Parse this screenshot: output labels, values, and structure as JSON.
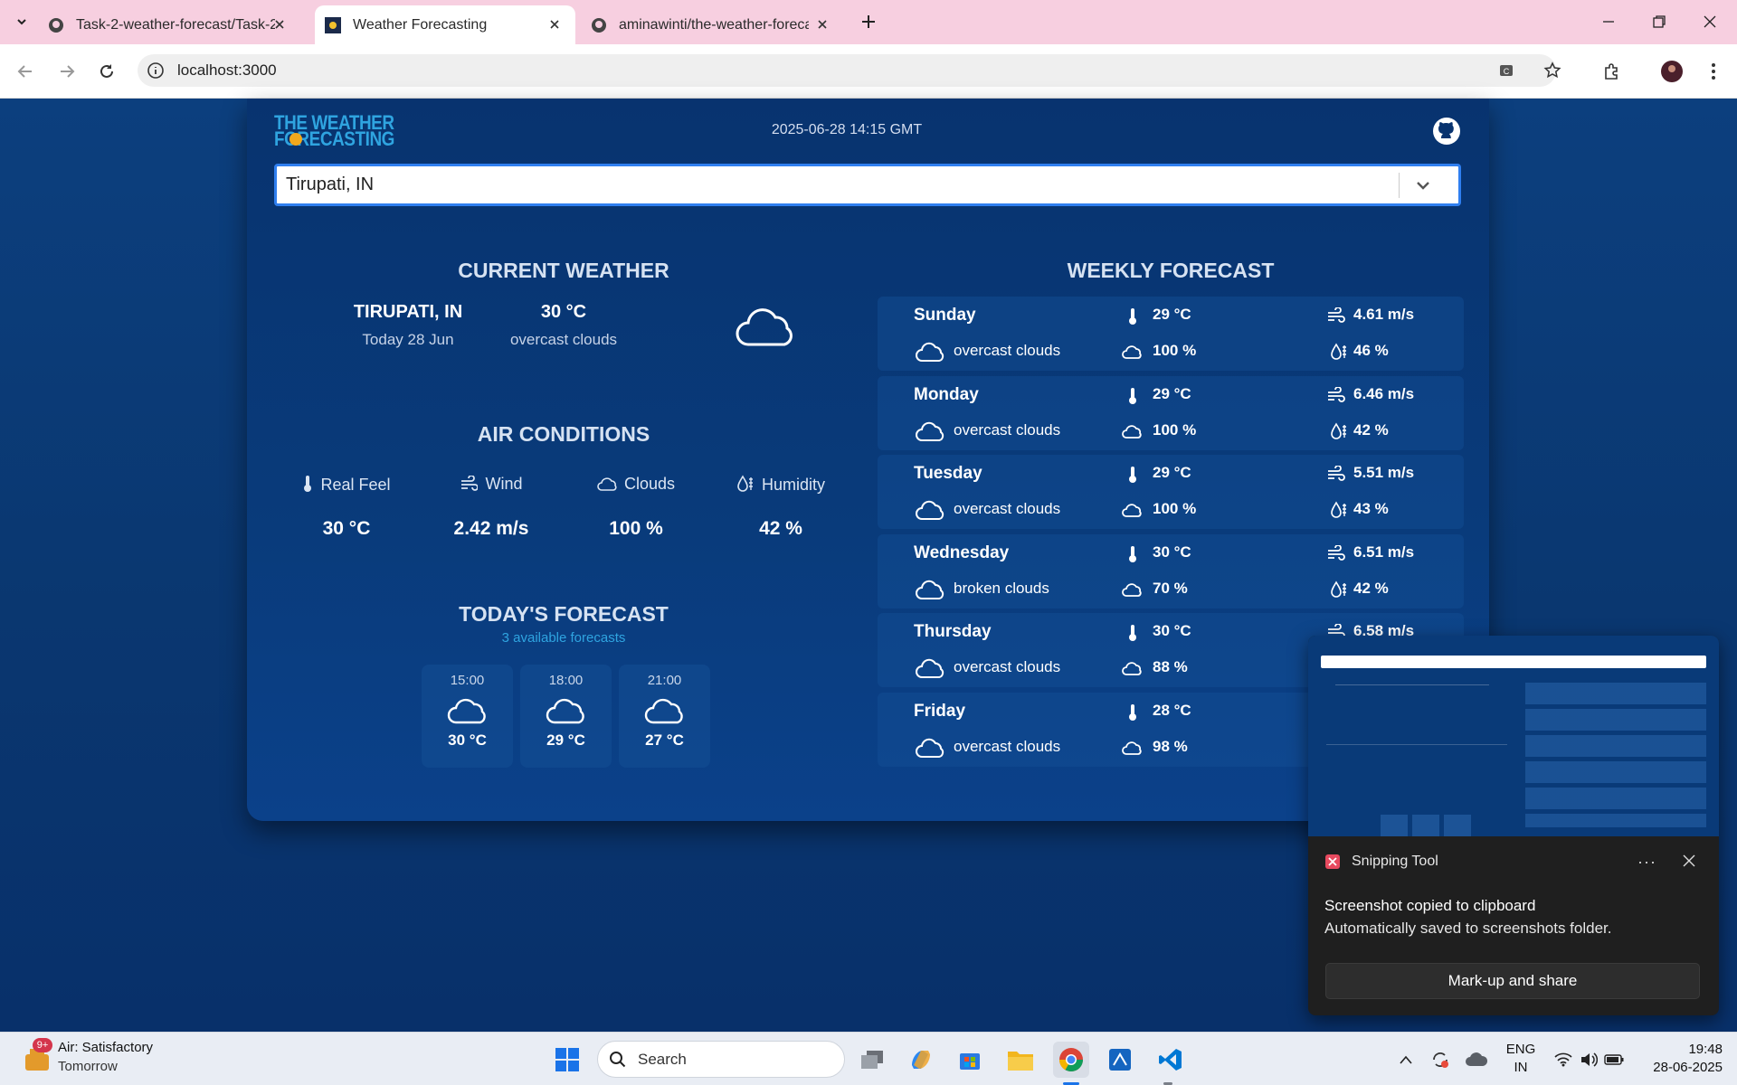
{
  "browser": {
    "tabs": [
      {
        "title": "Task-2-weather-forecast/Task-2",
        "active": false
      },
      {
        "title": "Weather Forecasting",
        "active": true
      },
      {
        "title": "aminawinti/the-weather-foreca",
        "active": false
      }
    ],
    "address": "localhost:3000"
  },
  "app": {
    "logo_line1": "THE WEATHER",
    "logo_line2": "FORECASTING",
    "datetime": "2025-06-28 14:15 GMT",
    "search_value": "Tirupati, IN"
  },
  "current": {
    "heading": "CURRENT WEATHER",
    "city": "TIRUPATI, IN",
    "date": "Today 28 Jun",
    "temp": "30 °C",
    "description": "overcast clouds"
  },
  "air": {
    "heading": "AIR CONDITIONS",
    "items": [
      {
        "label": "Real Feel",
        "value": "30 °C",
        "icon": "thermometer-icon"
      },
      {
        "label": "Wind",
        "value": "2.42 m/s",
        "icon": "wind-icon"
      },
      {
        "label": "Clouds",
        "value": "100 %",
        "icon": "cloud-icon"
      },
      {
        "label": "Humidity",
        "value": "42 %",
        "icon": "humidity-icon"
      }
    ]
  },
  "today": {
    "heading": "TODAY'S FORECAST",
    "subtitle": "3 available forecasts",
    "hours": [
      {
        "time": "15:00",
        "temp": "30 °C"
      },
      {
        "time": "18:00",
        "temp": "29 °C"
      },
      {
        "time": "21:00",
        "temp": "27 °C"
      }
    ]
  },
  "weekly": {
    "heading": "WEEKLY FORECAST",
    "days": [
      {
        "day": "Sunday",
        "desc": "overcast clouds",
        "temp": "29 °C",
        "clouds": "100 %",
        "wind": "4.61 m/s",
        "humidity": "46 %"
      },
      {
        "day": "Monday",
        "desc": "overcast clouds",
        "temp": "29 °C",
        "clouds": "100 %",
        "wind": "6.46 m/s",
        "humidity": "42 %"
      },
      {
        "day": "Tuesday",
        "desc": "overcast clouds",
        "temp": "29 °C",
        "clouds": "100 %",
        "wind": "5.51 m/s",
        "humidity": "43 %"
      },
      {
        "day": "Wednesday",
        "desc": "broken clouds",
        "temp": "30 °C",
        "clouds": "70 %",
        "wind": "6.51 m/s",
        "humidity": "42 %"
      },
      {
        "day": "Thursday",
        "desc": "overcast clouds",
        "temp": "30 °C",
        "clouds": "88 %",
        "wind": "6.58 m/s",
        "humidity": ""
      },
      {
        "day": "Friday",
        "desc": "overcast clouds",
        "temp": "28 °C",
        "clouds": "98 %",
        "wind": "",
        "humidity": ""
      }
    ]
  },
  "snipping": {
    "app_name": "Snipping Tool",
    "title": "Screenshot copied to clipboard",
    "body": "Automatically saved to screenshots folder.",
    "button": "Mark-up and share"
  },
  "taskbar": {
    "weather_badge": "9+",
    "weather_title": "Air: Satisfactory",
    "weather_sub": "Tomorrow",
    "search_placeholder": "Search",
    "lang1": "ENG",
    "lang2": "IN",
    "time": "19:48",
    "date": "28-06-2025"
  },
  "colors": {
    "tabstrip": "#f7cfe0",
    "page_bg": "#0b3d7a",
    "accent_blue": "#2fa4e0",
    "logo_orange": "#f2a81d"
  }
}
